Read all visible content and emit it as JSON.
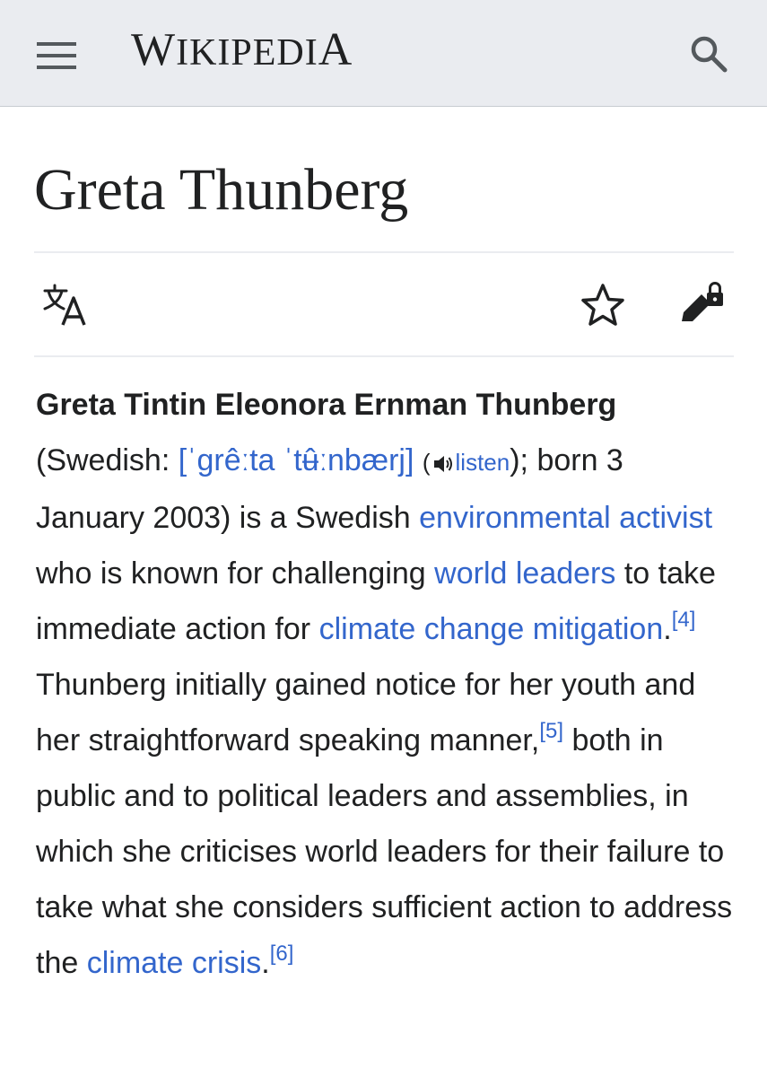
{
  "header": {
    "menu_icon": "hamburger-menu-icon",
    "wordmark_first": "W",
    "wordmark_mid": "IKIPEDI",
    "wordmark_last": "A",
    "search_icon": "search-icon"
  },
  "article": {
    "title": "Greta Thunberg",
    "actions": {
      "language_icon": "language-icon",
      "watch_icon": "star-icon",
      "edit_icon": "edit-locked-icon"
    }
  },
  "lead": {
    "full_name": "Greta Tintin Eleonora Ernman Thunberg",
    "paren_open": " (Swedish: ",
    "ipa": "[ˈɡrêːta ˈtʉ̂ːnbærj]",
    "space": " ",
    "audio_open": "(",
    "audio_icon": "speaker-icon",
    "listen": "listen",
    "audio_close": ")",
    "after_audio": "; born 3 January 2003) is a Swedish ",
    "link_environmental_activist": "environmental activist",
    "t1": " who is known for challenging ",
    "link_world_leaders": "world leaders",
    "t2": " to take immediate action for ",
    "link_climate_change_mitigation": "climate change mitigation",
    "t3": ".",
    "ref4": "[4]",
    "t4": " Thunberg initially gained notice for her youth and her straightforward speaking manner,",
    "ref5": "[5]",
    "t5": " both in public and to political leaders and assemblies, in which she criticises world leaders for their failure to take what she considers sufficient action to address the ",
    "link_climate_crisis": "climate crisis",
    "t6": ".",
    "ref6": "[6]"
  },
  "colors": {
    "header_bg": "#eaecf0",
    "link": "#3366cc",
    "text": "#202122",
    "divider": "#eaecf0"
  }
}
